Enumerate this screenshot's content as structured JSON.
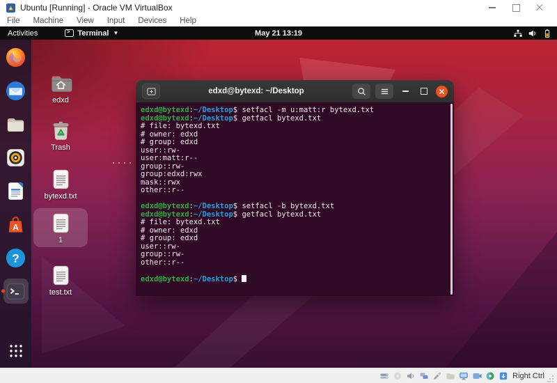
{
  "vbox": {
    "title": "Ubuntu [Running] - Oracle VM VirtualBox",
    "menu": [
      "File",
      "Machine",
      "View",
      "Input",
      "Devices",
      "Help"
    ],
    "window_controls": [
      "minimize-icon",
      "maximize-icon",
      "close-icon"
    ],
    "status_icons": [
      "vb-hdd-icon",
      "vb-optical-icon",
      "vb-audio-icon",
      "vb-network-icon",
      "vb-usb-icon",
      "vb-folders-icon",
      "vb-display-icon",
      "vb-recording-icon",
      "vb-mouse-icon",
      "vb-keyboard-icon"
    ],
    "host_key": "Right Ctrl"
  },
  "topbar": {
    "activities_label": "Activities",
    "app_label": "Terminal",
    "clock": "May 21 13:19",
    "right_icons": [
      "network-icon",
      "volume-icon",
      "battery-icon"
    ]
  },
  "dock": {
    "items": [
      {
        "id": "firefox"
      },
      {
        "id": "thunderbird"
      },
      {
        "id": "files"
      },
      {
        "id": "rhythmbox"
      },
      {
        "id": "libreoffice-writer"
      },
      {
        "id": "ubuntu-software"
      },
      {
        "id": "help"
      },
      {
        "id": "terminal",
        "running": true,
        "active": true
      }
    ],
    "show_apps": "show-apps"
  },
  "desktop_icons": [
    {
      "label": "edxd",
      "kind": "folder-home",
      "selected": false
    },
    {
      "label": "Trash",
      "kind": "trash",
      "selected": false
    },
    {
      "label": "bytexd.txt",
      "kind": "text",
      "selected": false
    },
    {
      "label": "1",
      "kind": "text",
      "selected": true
    },
    {
      "label": "test.txt",
      "kind": "text",
      "selected": false
    }
  ],
  "terminal": {
    "title": "edxd@bytexd: ~/Desktop",
    "colors": {
      "bg": "#300a24",
      "user_green": "#2fae43",
      "path_blue": "#1ea3e0",
      "fg": "#efe9ed",
      "close_orange": "#ea5420"
    },
    "prompt": {
      "user": "edxd@bytexd",
      "sep": ":",
      "path": "~/Desktop",
      "dollar": "$ "
    },
    "lines": [
      {
        "cmd": "setfacl -m u:matt:r bytexd.txt"
      },
      {
        "cmd": "getfacl bytexd.txt"
      },
      {
        "out": "# file: bytexd.txt"
      },
      {
        "out": "# owner: edxd"
      },
      {
        "out": "# group: edxd"
      },
      {
        "out": "user::rw-"
      },
      {
        "out": "user:matt:r--"
      },
      {
        "out": "group::rw-"
      },
      {
        "out": "group:edxd:rwx"
      },
      {
        "out": "mask::rwx"
      },
      {
        "out": "other::r--"
      },
      {
        "out": ""
      },
      {
        "cmd": "setfacl -b bytexd.txt"
      },
      {
        "cmd": "getfacl bytexd.txt"
      },
      {
        "out": "# file: bytexd.txt"
      },
      {
        "out": "# owner: edxd"
      },
      {
        "out": "# group: edxd"
      },
      {
        "out": "user::rw-"
      },
      {
        "out": "group::rw-"
      },
      {
        "out": "other::r--"
      },
      {
        "out": ""
      },
      {
        "cmd": "",
        "cursor": true
      }
    ]
  }
}
